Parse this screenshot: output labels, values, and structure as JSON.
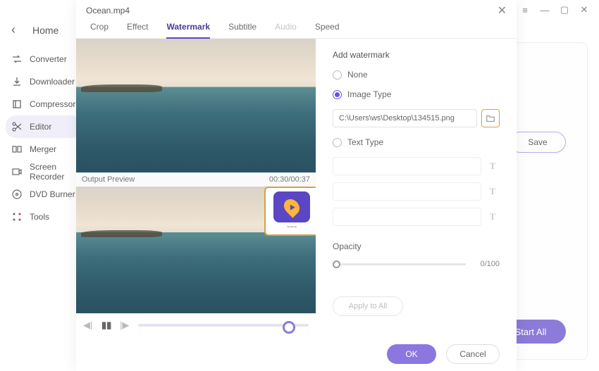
{
  "window": {
    "title": "Ocean.mp4"
  },
  "bg": {
    "home": "Home",
    "save": "Save",
    "start_all": "Start All"
  },
  "sidebar": {
    "items": [
      {
        "id": "converter",
        "label": "Converter"
      },
      {
        "id": "downloader",
        "label": "Downloader"
      },
      {
        "id": "compressor",
        "label": "Compressor"
      },
      {
        "id": "editor",
        "label": "Editor"
      },
      {
        "id": "merger",
        "label": "Merger"
      },
      {
        "id": "recorder",
        "label": "Screen Recorder"
      },
      {
        "id": "dvd",
        "label": "DVD Burner"
      },
      {
        "id": "tools",
        "label": "Tools"
      }
    ],
    "active_index": 3
  },
  "tabs": {
    "items": [
      "Crop",
      "Effect",
      "Watermark",
      "Subtitle",
      "Audio",
      "Speed"
    ],
    "active_index": 2,
    "disabled_indices": [
      4
    ]
  },
  "preview": {
    "output_label": "Output Preview",
    "time": "00:30/00:37",
    "wm_brand": "~~~"
  },
  "panel": {
    "title": "Add watermark",
    "none_label": "None",
    "image_label": "Image Type",
    "image_path": "C:\\Users\\ws\\Desktop\\134515.png",
    "text_label": "Text Type",
    "opacity_label": "Opacity",
    "opacity_value": "0/100",
    "apply_all": "Apply to All",
    "text_btn_glyph": "T"
  },
  "footer": {
    "ok": "OK",
    "cancel": "Cancel"
  }
}
